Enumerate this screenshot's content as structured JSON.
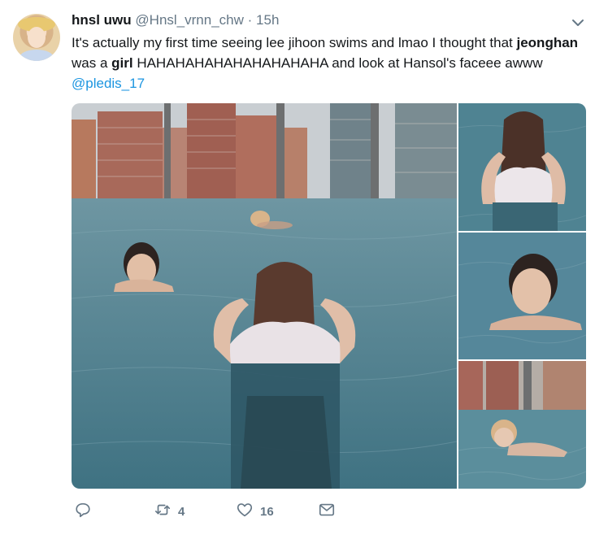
{
  "tweet": {
    "display_name": "hnsl uwu",
    "handle": "@Hnsl_vrnn_chw",
    "separator": "·",
    "time": "15h",
    "text": {
      "p1": "It's actually my first time seeing lee jihoon swims and lmao I thought that ",
      "b1": "jeonghan",
      "p2": " was a ",
      "b2": "girl",
      "p3": " HAHAHAHAHAHAHAHAHAHA and look at Hansol's faceee awww ",
      "mention": "@pledis_17"
    }
  },
  "actions": {
    "reply_count": "",
    "retweet_count": "4",
    "like_count": "16"
  },
  "icons": {
    "more": "chevron-down-icon",
    "reply": "reply-icon",
    "retweet": "retweet-icon",
    "like": "heart-icon",
    "message": "envelope-icon"
  },
  "colors": {
    "text": "#14171a",
    "secondary": "#657786",
    "link": "#1b95e0",
    "pool_water": "#4f8392"
  }
}
